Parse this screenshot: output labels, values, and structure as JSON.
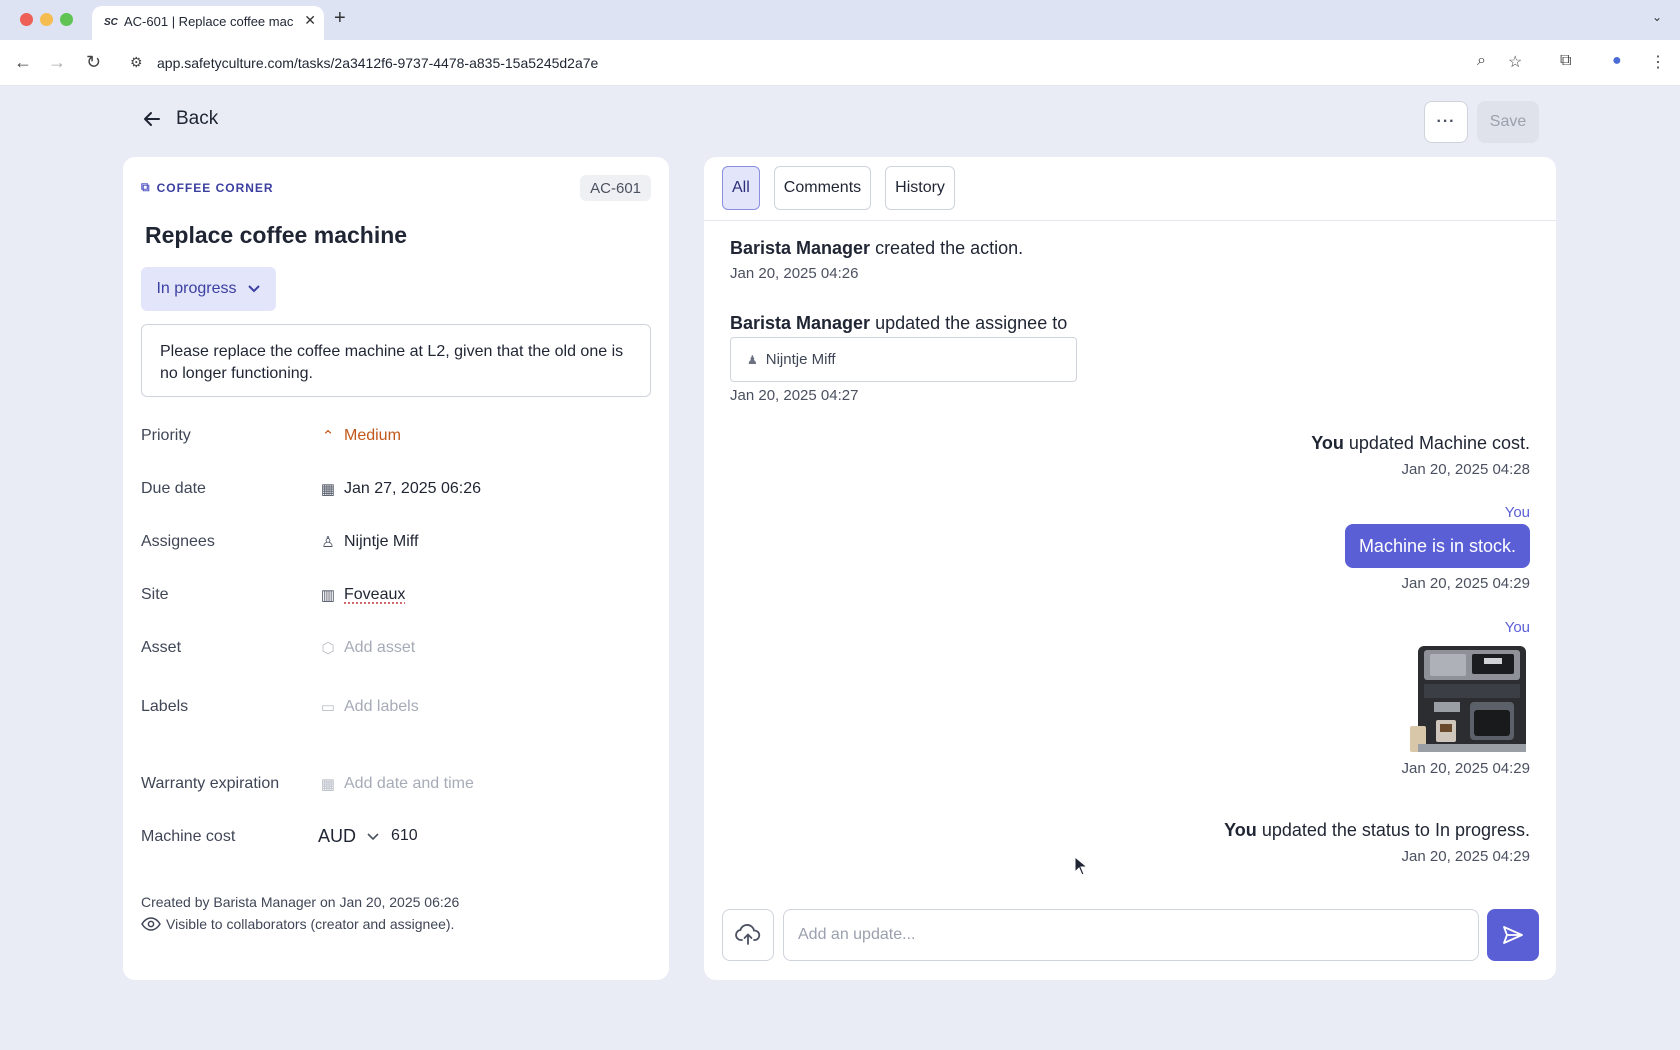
{
  "browser": {
    "tab_favicon": "SC",
    "tab_title": "AC-601 | Replace coffee machine",
    "url": "app.safetyculture.com/tasks/2a3412f6-9737-4478-a835-15a5245d2a7e"
  },
  "header": {
    "back_label": "Back",
    "more_label": "···",
    "save_label": "Save"
  },
  "task": {
    "folder": "COFFEE CORNER",
    "id": "AC-601",
    "title": "Replace coffee machine",
    "status": "In progress",
    "description": "Please replace the coffee machine at L2, given that the old one is no longer functioning.",
    "fields": {
      "priority": {
        "label": "Priority",
        "value": "Medium"
      },
      "due_date": {
        "label": "Due date",
        "value": "Jan 27, 2025 06:26"
      },
      "assignees": {
        "label": "Assignees",
        "value": "Nijntje Miff"
      },
      "site": {
        "label": "Site",
        "value": "Foveaux"
      },
      "asset": {
        "label": "Asset",
        "value": "Add asset"
      },
      "labels": {
        "label": "Labels",
        "value": "Add labels"
      },
      "warranty": {
        "label": "Warranty expiration",
        "value": "Add date and time"
      },
      "machine_cost": {
        "label": "Machine cost",
        "currency": "AUD",
        "value": "610"
      }
    },
    "created_text": "Created by Barista Manager on Jan 20, 2025 06:26",
    "visibility_text": "Visible to collaborators (creator and assignee)."
  },
  "feed": {
    "tabs": [
      "All",
      "Comments",
      "History"
    ],
    "active_tab": "All",
    "events": {
      "e1": {
        "actor": "Barista Manager",
        "text": " created the action.",
        "time": "Jan 20, 2025 04:26"
      },
      "e2": {
        "actor": "Barista Manager",
        "text": " updated the assignee to",
        "assignee": "Nijntje Miff",
        "time": "Jan 20, 2025 04:27"
      },
      "e3": {
        "actor": "You",
        "text": " updated Machine cost.",
        "time": "Jan 20, 2025 04:28"
      },
      "e4": {
        "author": "You",
        "message": "Machine is in stock.",
        "time": "Jan 20, 2025 04:29"
      },
      "e5": {
        "author": "You",
        "image": "coffee-machine-photo",
        "time": "Jan 20, 2025 04:29"
      },
      "e6": {
        "actor": "You",
        "text": " updated the status to In progress.",
        "time": "Jan 20, 2025 04:29"
      }
    },
    "composer_placeholder": "Add an update..."
  },
  "colors": {
    "accent": "#5b5fd6",
    "accent_light": "#e3e5fb",
    "priority_medium": "#c2571a",
    "page_bg": "#e9ecf5"
  }
}
